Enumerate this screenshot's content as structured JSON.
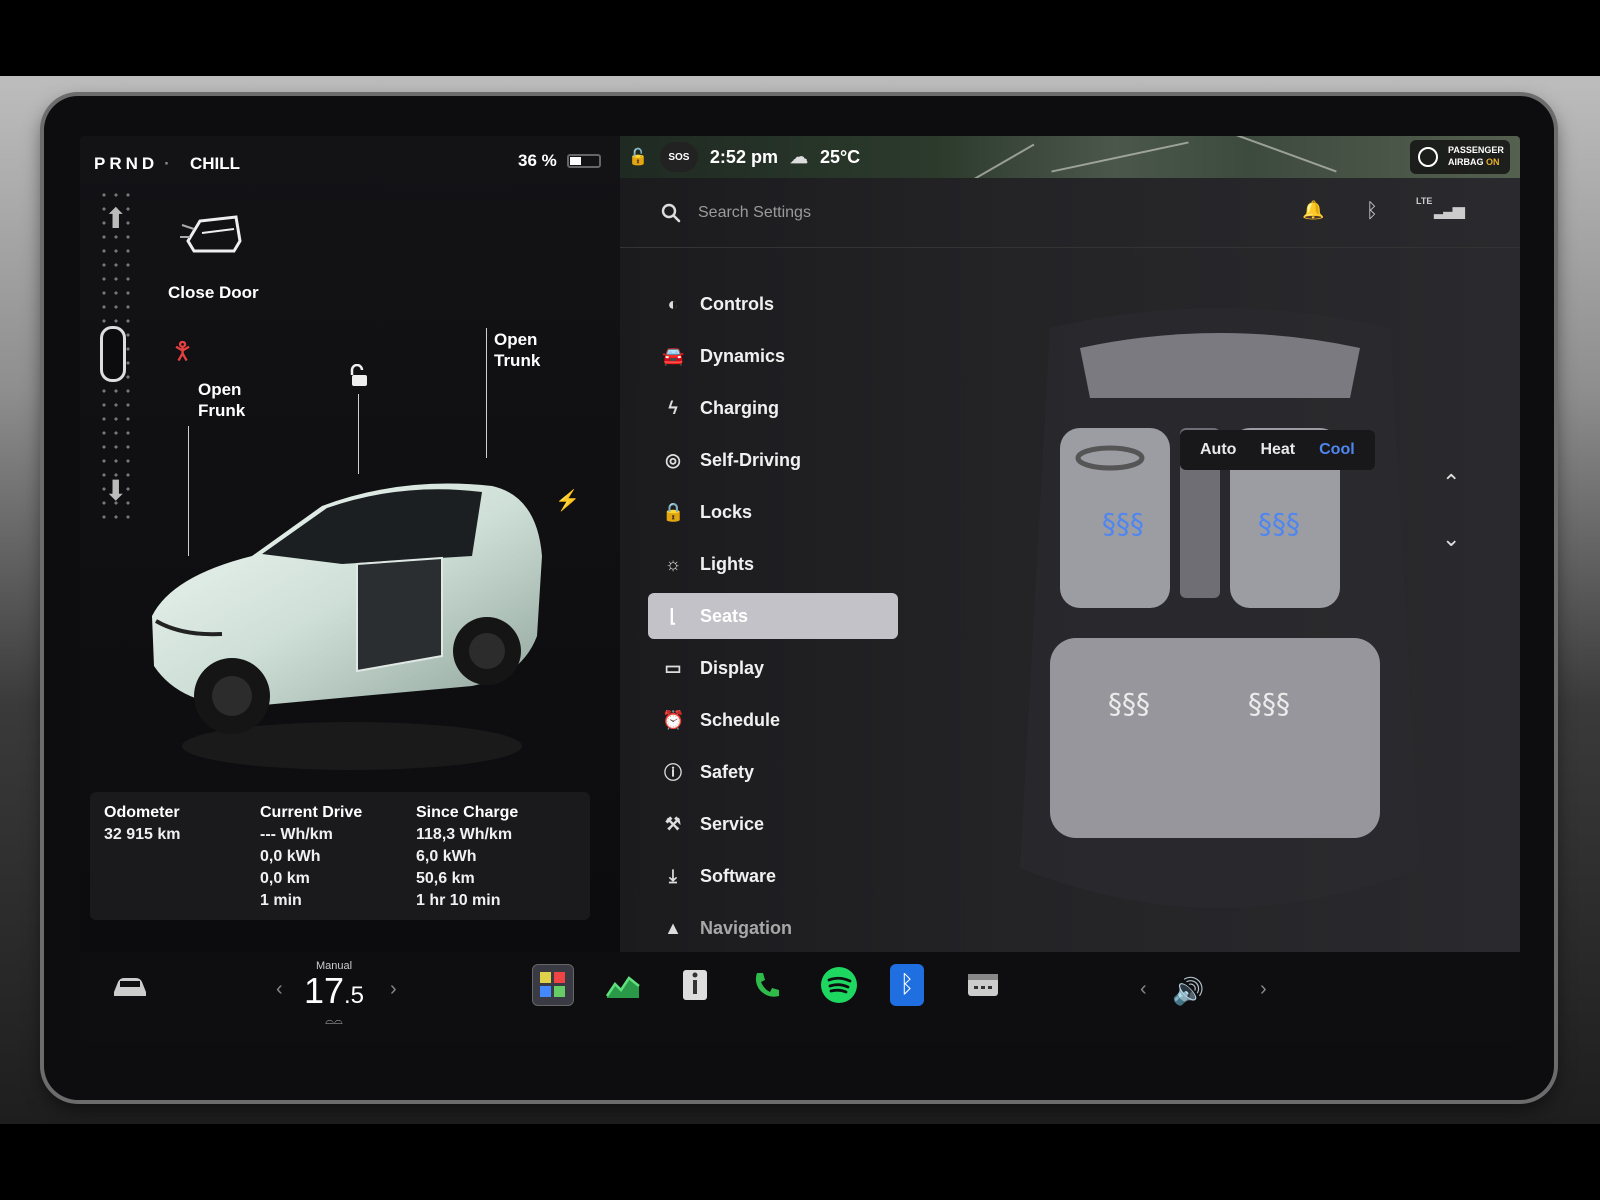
{
  "drive": {
    "gears": "PRND",
    "mode": "CHILL",
    "battery_percent": "36 %",
    "battery_level": 0.36
  },
  "car_panel": {
    "close_door": "Close Door",
    "open_frunk": "Open Frunk",
    "open_trunk": "Open Trunk"
  },
  "stats": {
    "odometer": {
      "label": "Odometer",
      "value": "32 915 km"
    },
    "current_drive": {
      "label": "Current Drive",
      "values": [
        "--- Wh/km",
        "0,0 kWh",
        "0,0 km",
        "1 min"
      ]
    },
    "since_charge": {
      "label": "Since Charge",
      "values": [
        "118,3 Wh/km",
        "6,0 kWh",
        "50,6 km",
        "1 hr 10 min"
      ]
    }
  },
  "status": {
    "sos": "SOS",
    "time": "2:52 pm",
    "temperature": "25°C"
  },
  "airbag": {
    "line1": "PASSENGER",
    "line2a": "AIRBAG ",
    "line2b": "ON",
    "on_color": "#e6b030"
  },
  "settings": {
    "search_placeholder": "Search Settings",
    "network": "LTE",
    "menu": [
      {
        "label": "Controls",
        "icon": "toggle-icon"
      },
      {
        "label": "Dynamics",
        "icon": "car-icon"
      },
      {
        "label": "Charging",
        "icon": "bolt-icon"
      },
      {
        "label": "Self-Driving",
        "icon": "steering-wheel-icon"
      },
      {
        "label": "Locks",
        "icon": "lock-icon"
      },
      {
        "label": "Lights",
        "icon": "sun-icon"
      },
      {
        "label": "Seats",
        "icon": "seat-icon",
        "active": true
      },
      {
        "label": "Display",
        "icon": "display-icon"
      },
      {
        "label": "Schedule",
        "icon": "alarm-icon"
      },
      {
        "label": "Safety",
        "icon": "alert-icon"
      },
      {
        "label": "Service",
        "icon": "wrench-icon"
      },
      {
        "label": "Software",
        "icon": "download-icon"
      },
      {
        "label": "Navigation",
        "icon": "navigation-icon"
      }
    ],
    "climate_modes": [
      "Auto",
      "Heat",
      "Cool"
    ],
    "climate_active": "Cool",
    "accent": "#4f86f0"
  },
  "dock": {
    "temp_mode": "Manual",
    "temp_int": "17",
    "temp_dec": ".5"
  }
}
